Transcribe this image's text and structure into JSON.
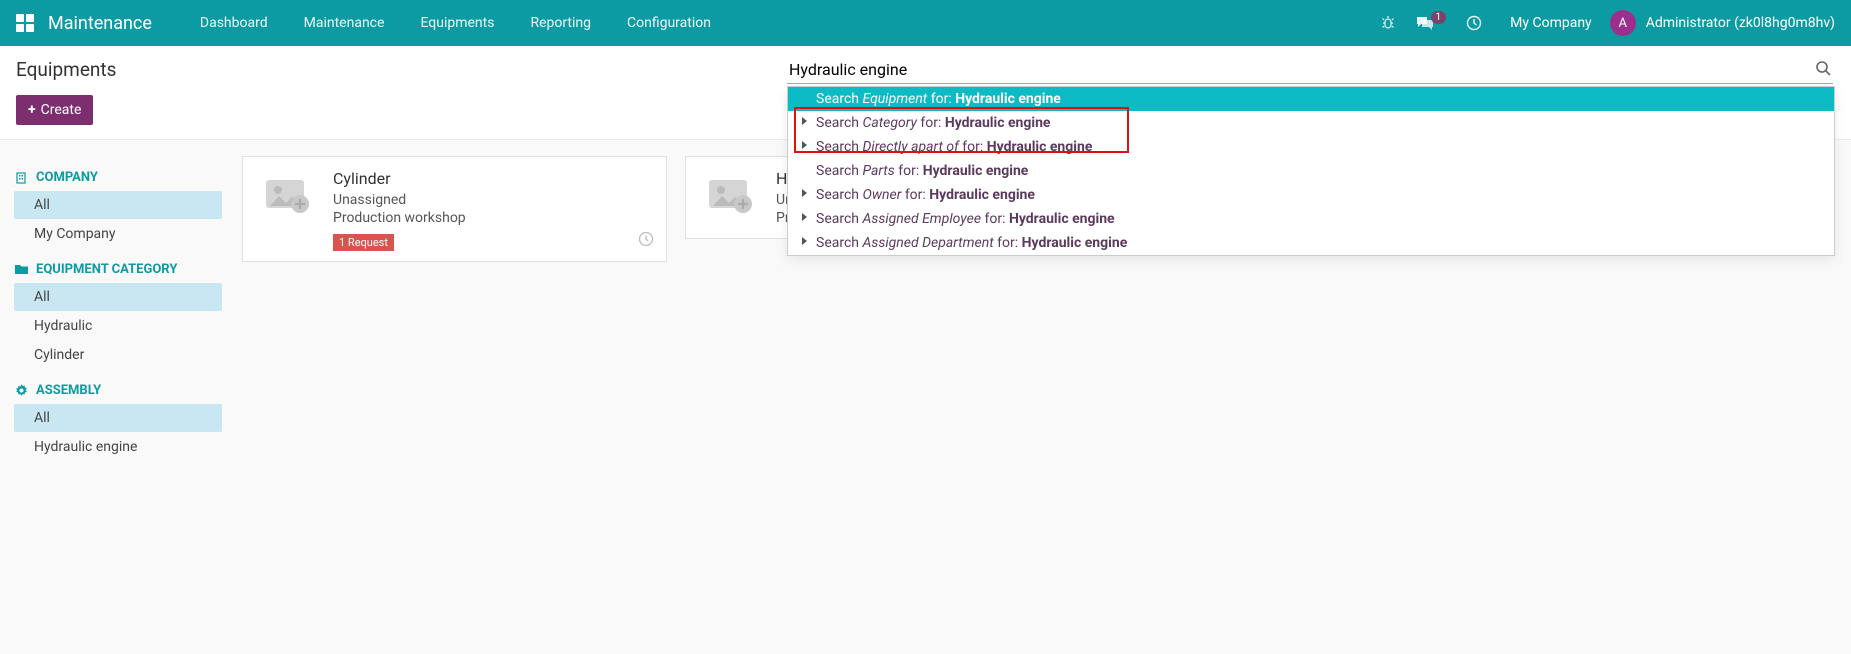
{
  "nav": {
    "brand": "Maintenance",
    "items": [
      "Dashboard",
      "Maintenance",
      "Equipments",
      "Reporting",
      "Configuration"
    ],
    "messaging_count": "1",
    "company": "My Company",
    "avatar_initial": "A",
    "username": "Administrator (zk0l8hg0m8hv)"
  },
  "page": {
    "title": "Equipments",
    "create_label": "Create"
  },
  "search": {
    "value": "Hydraulic engine",
    "options": [
      {
        "label": "Search ",
        "field": "Equipment",
        "mid": " for: ",
        "term": "Hydraulic engine",
        "chev": false,
        "selected": true
      },
      {
        "label": "Search ",
        "field": "Category",
        "mid": " for: ",
        "term": "Hydraulic engine",
        "chev": true,
        "selected": false
      },
      {
        "label": "Search ",
        "field": "Directly apart of",
        "mid": " for: ",
        "term": "Hydraulic engine",
        "chev": true,
        "selected": false
      },
      {
        "label": "Search ",
        "field": "Parts",
        "mid": " for: ",
        "term": "Hydraulic engine",
        "chev": false,
        "selected": false
      },
      {
        "label": "Search ",
        "field": "Owner",
        "mid": " for: ",
        "term": "Hydraulic engine",
        "chev": true,
        "selected": false
      },
      {
        "label": "Search ",
        "field": "Assigned Employee",
        "mid": " for: ",
        "term": "Hydraulic engine",
        "chev": true,
        "selected": false
      },
      {
        "label": "Search ",
        "field": "Assigned Department",
        "mid": " for: ",
        "term": "Hydraulic engine",
        "chev": true,
        "selected": false
      }
    ]
  },
  "sidebar": {
    "sections": [
      {
        "title": "COMPANY",
        "icon": "building",
        "items": [
          {
            "label": "All",
            "active": true
          },
          {
            "label": "My Company",
            "active": false
          }
        ]
      },
      {
        "title": "EQUIPMENT CATEGORY",
        "icon": "folder",
        "items": [
          {
            "label": "All",
            "active": true
          },
          {
            "label": "Hydraulic",
            "active": false
          },
          {
            "label": "Cylinder",
            "active": false
          }
        ]
      },
      {
        "title": "ASSEMBLY",
        "icon": "gear",
        "items": [
          {
            "label": "All",
            "active": true
          },
          {
            "label": "Hydraulic engine",
            "active": false
          }
        ]
      }
    ]
  },
  "cards": [
    {
      "title": "Cylinder",
      "assignee": "Unassigned",
      "location": "Production workshop",
      "badge": "1 Request"
    },
    {
      "title": "Hy",
      "assignee": "Un",
      "location": "Pr",
      "badge": ""
    }
  ]
}
